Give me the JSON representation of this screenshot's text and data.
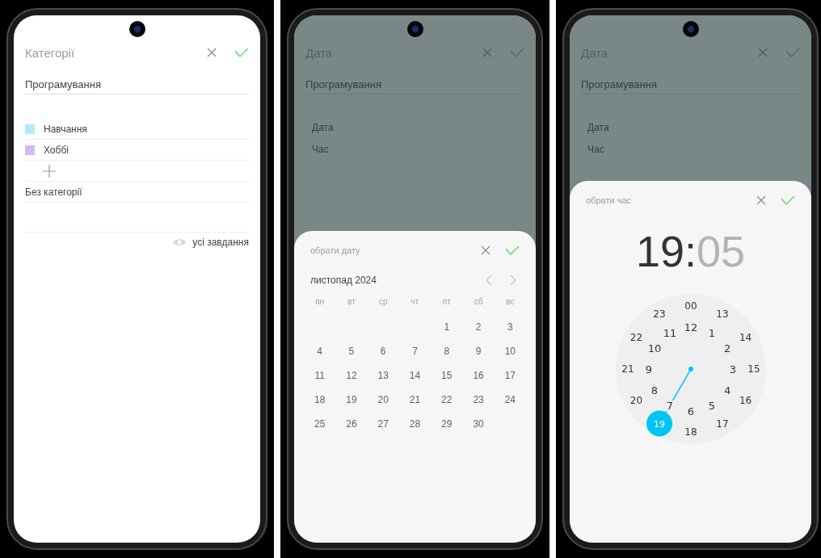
{
  "categories_screen": {
    "title": "Категорії",
    "name_value": "Програмування",
    "categories": [
      {
        "label": "Навчання",
        "color": "#b5ebfa"
      },
      {
        "label": "Хоббі",
        "color": "#d7b9fa"
      }
    ],
    "uncategorized": "Без категорії",
    "show_all": "усі завдання"
  },
  "date_screen": {
    "background": {
      "title": "Дата",
      "name_value": "Програмування",
      "rows": [
        "Дата",
        "Час"
      ],
      "dimmed": true
    },
    "sheet": {
      "title": "обрати дату",
      "month": "листопад 2024",
      "weekdays": [
        "пн",
        "вт",
        "ср",
        "чт",
        "пт",
        "сб",
        "вс"
      ],
      "weeks": [
        {
          "kind": "first",
          "days": [
            "1",
            "2",
            "3"
          ]
        },
        {
          "kind": "week",
          "days": [
            "4",
            "5",
            "6",
            "7",
            "8",
            "9",
            "10"
          ]
        },
        {
          "kind": "week",
          "days": [
            "11",
            "12",
            "13",
            "14",
            "15",
            "16",
            "17"
          ]
        },
        {
          "kind": "week",
          "days": [
            "18",
            "19",
            "20",
            "21",
            "22",
            "23",
            "24"
          ]
        },
        {
          "kind": "week",
          "days": [
            "25",
            "26",
            "27",
            "28",
            "29",
            "30"
          ]
        }
      ]
    }
  },
  "time_screen": {
    "background": {
      "title": "Дата",
      "name_value": "Програмування",
      "rows": [
        "Дата",
        "Час"
      ],
      "dimmed": true
    },
    "sheet": {
      "title": "обрати час",
      "hours": {
        "text": "19",
        "selected": true
      },
      "separator": ":",
      "minutes": {
        "text": "05",
        "selected": false
      },
      "outer_ring": [
        {
          "label": "00",
          "selected": false
        },
        {
          "label": "13",
          "selected": false
        },
        {
          "label": "14",
          "selected": false
        },
        {
          "label": "15",
          "selected": false
        },
        {
          "label": "16",
          "selected": false
        },
        {
          "label": "17",
          "selected": false
        },
        {
          "label": "18",
          "selected": false
        },
        {
          "label": "19",
          "selected": true
        },
        {
          "label": "20",
          "selected": false
        },
        {
          "label": "21",
          "selected": false
        },
        {
          "label": "22",
          "selected": false
        },
        {
          "label": "23",
          "selected": false
        }
      ],
      "inner_ring": [
        {
          "label": "12",
          "selected": false
        },
        {
          "label": "1",
          "selected": false
        },
        {
          "label": "2",
          "selected": false
        },
        {
          "label": "3",
          "selected": false
        },
        {
          "label": "4",
          "selected": false
        },
        {
          "label": "5",
          "selected": false
        },
        {
          "label": "6",
          "selected": false
        },
        {
          "label": "7",
          "selected": false
        },
        {
          "label": "8",
          "selected": false
        },
        {
          "label": "9",
          "selected": false
        },
        {
          "label": "10",
          "selected": false
        },
        {
          "label": "11",
          "selected": false
        }
      ]
    }
  }
}
